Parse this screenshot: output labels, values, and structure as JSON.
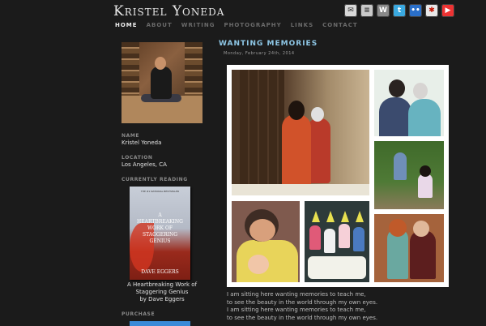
{
  "header": {
    "logo": "Kristel Yoneda",
    "social_icons": [
      "mail-icon",
      "blog-icon",
      "wordpress-icon",
      "twitter-icon",
      "flickr-icon",
      "yelp-icon",
      "youtube-icon"
    ]
  },
  "nav": {
    "items": [
      {
        "label": "HOME",
        "active": true
      },
      {
        "label": "ABOUT",
        "active": false
      },
      {
        "label": "WRITING",
        "active": false
      },
      {
        "label": "PHOTOGRAPHY",
        "active": false
      },
      {
        "label": "LINKS",
        "active": false
      },
      {
        "label": "CONTACT",
        "active": false
      }
    ]
  },
  "sidebar": {
    "name_label": "NAME",
    "name_value": "Kristel Yoneda",
    "location_label": "LOCATION",
    "location_value": "Los Angeles, CA",
    "reading_label": "CURRENTLY READING",
    "book": {
      "cover_header": "THE #1 NATIONAL BESTSELLER",
      "cover_title": "A HEARTBREAKING WORK OF STAGGERING GENIUS",
      "cover_author": "DAVE EGGERS",
      "caption_title": "A Heartbreaking Work of Staggering Genius",
      "caption_author": "by Dave Eggers"
    },
    "purchase_label": "PURCHASE"
  },
  "post": {
    "title": "WANTING MEMORIES",
    "date": "Monday, February 24th, 2014",
    "lines": [
      "I am sitting here wanting memories to teach me,",
      "to see the beauty in the world through my own eyes.",
      "I am sitting here wanting memories to teach me,",
      "to see the beauty in the world through my own eyes."
    ]
  },
  "colors": {
    "background": "#1b1b1b",
    "accent": "#8ec7e6",
    "nav_active": "#f0f0f0",
    "nav_inactive": "#6a6a6a"
  }
}
